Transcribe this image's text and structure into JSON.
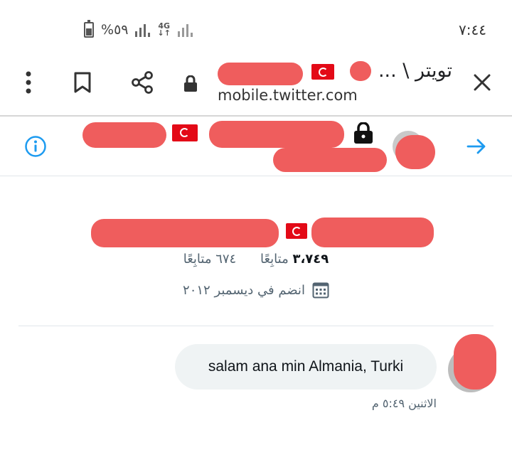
{
  "status_bar": {
    "time": "٧:٤٤",
    "battery_percent": "%٥٩",
    "network": "4G"
  },
  "browser": {
    "title": "تويتر \\ ...",
    "url": "mobile.twitter.com"
  },
  "profile": {
    "following_count": "٣،٧٤٩",
    "following_label": "متابِعًا",
    "followers_count": "٦٧٤",
    "followers_label": "متابِعًا",
    "joined": "انضم في ديسمبر ٢٠١٢"
  },
  "message": {
    "text": "salam ana min Almania, Turki",
    "timestamp": "الاثنين ٥:٤٩ م"
  },
  "colors": {
    "accent": "#1d9bf0",
    "redaction": "#ef5d5d",
    "flag": "#e30a17"
  },
  "icons": [
    "battery-icon",
    "signal-icon",
    "close-icon",
    "lock-icon",
    "share-icon",
    "bookmark-icon",
    "menu-dots-icon",
    "arrow-right-icon",
    "info-icon",
    "calendar-icon"
  ]
}
